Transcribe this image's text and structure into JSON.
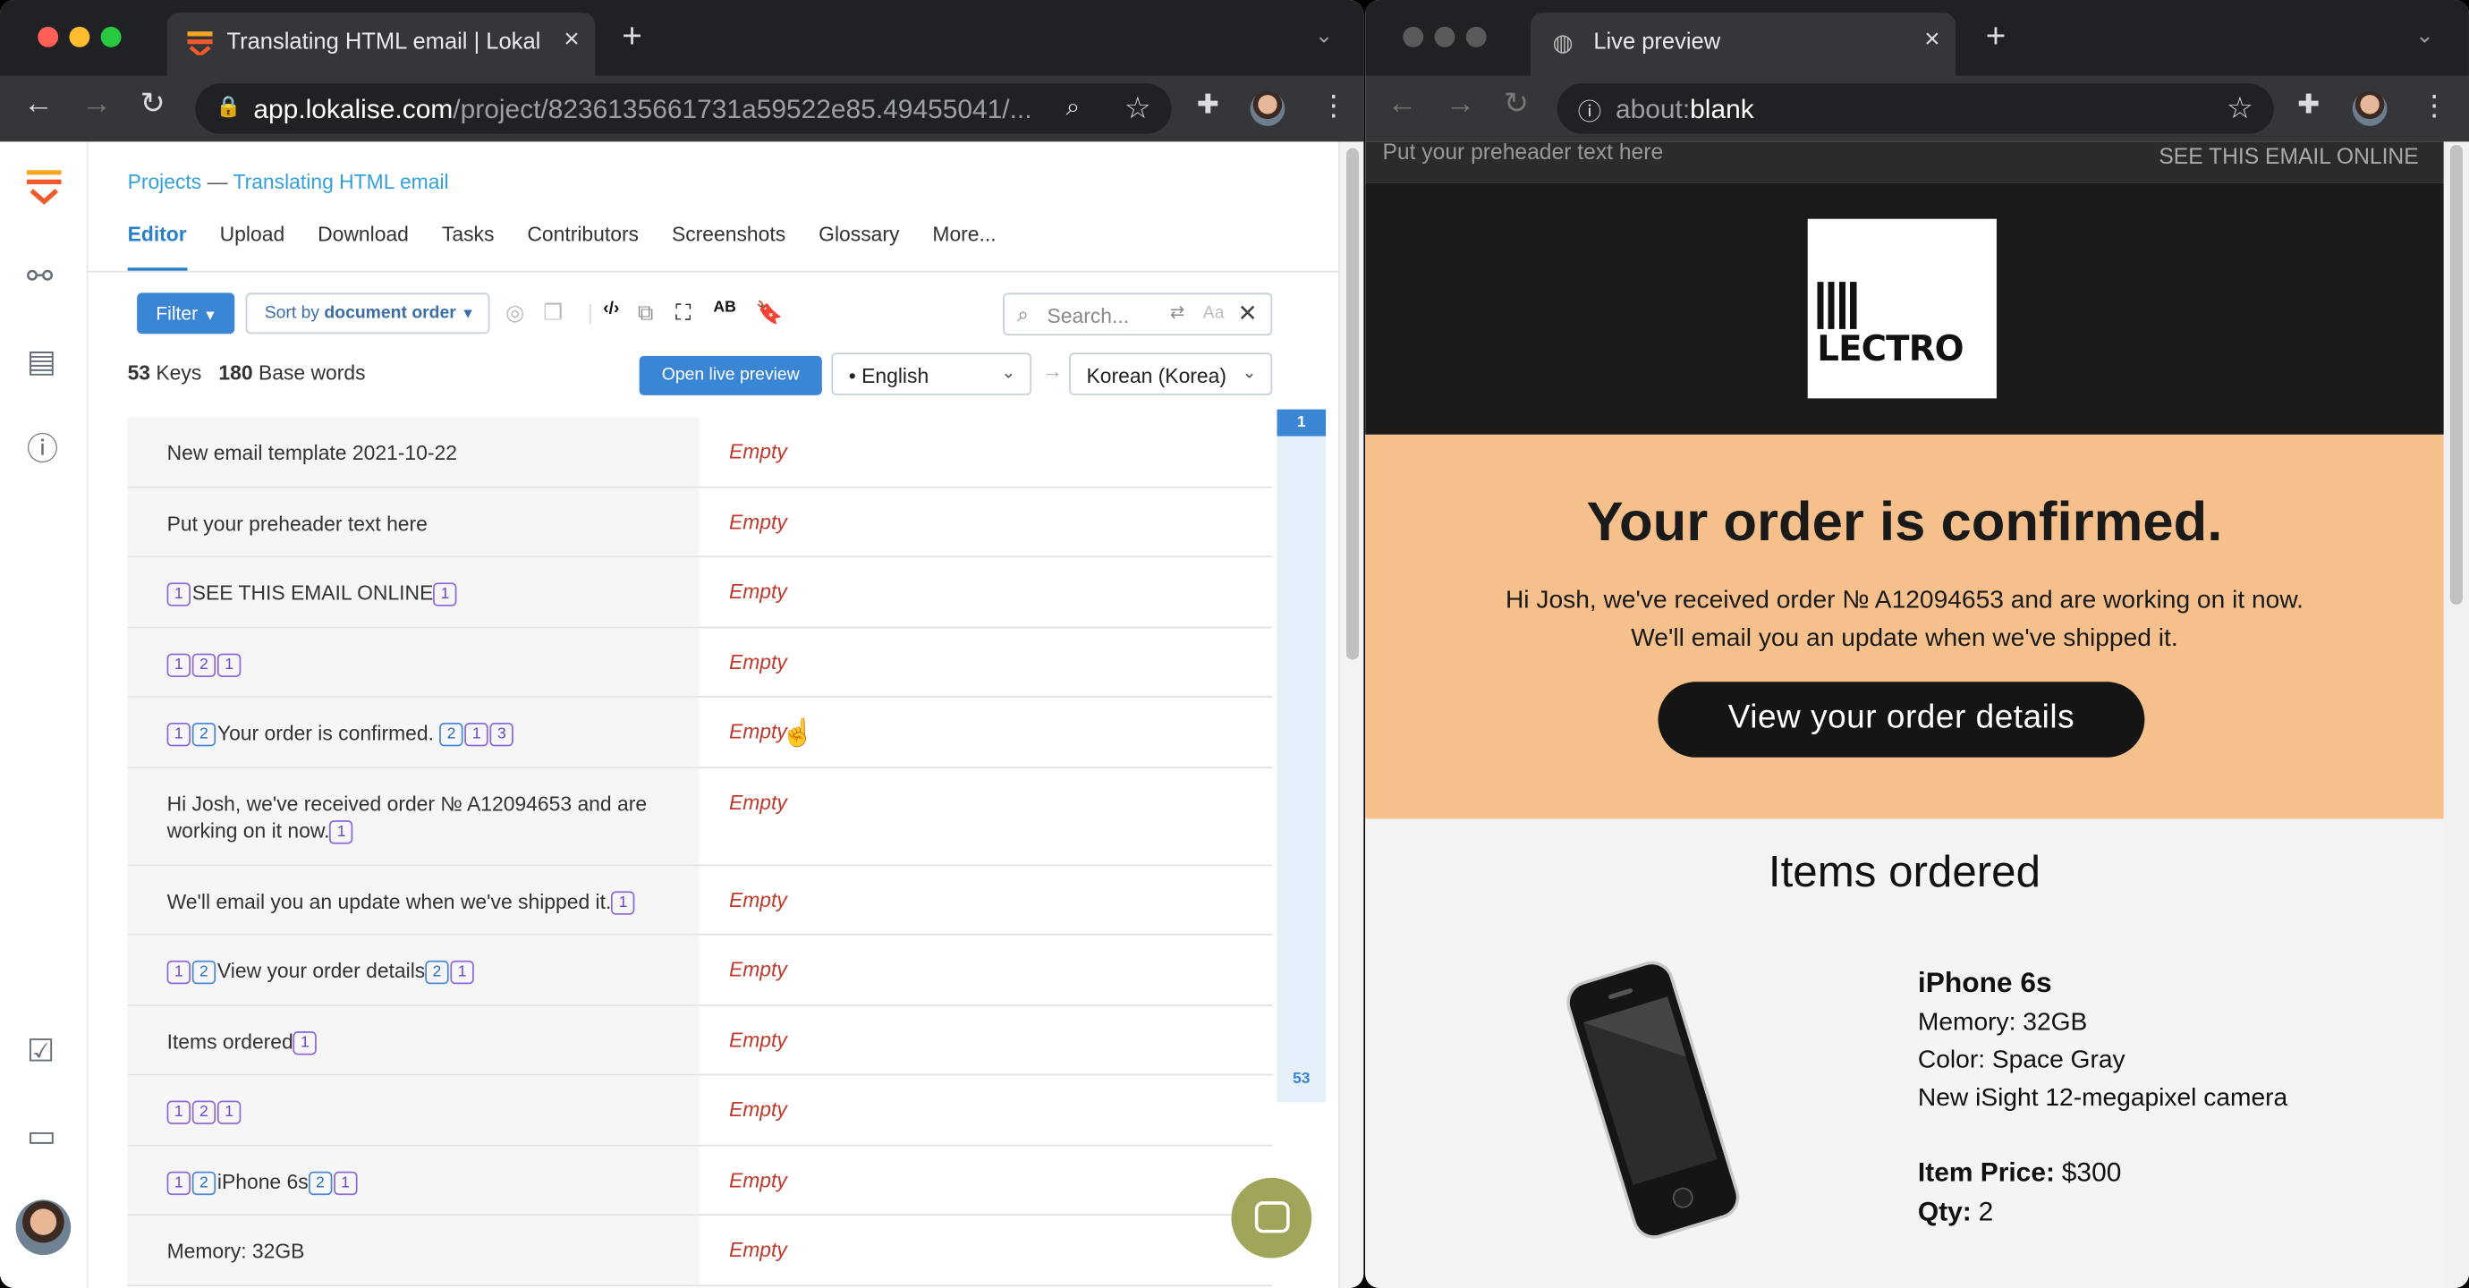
{
  "left_window": {
    "tab_title": "Translating HTML email | Lokali",
    "url_domain": "app.lokalise.com",
    "url_path": "/project/8236135661731a59522e85.49455041/..."
  },
  "right_window": {
    "tab_title": "Live preview",
    "url_prefix": "about:",
    "url_rest": "blank"
  },
  "lokalise": {
    "breadcrumb_projects": "Projects",
    "breadcrumb_sep": " — ",
    "breadcrumb_project": "Translating HTML email",
    "nav": [
      "Editor",
      "Upload",
      "Download",
      "Tasks",
      "Contributors",
      "Screenshots",
      "Glossary",
      "More..."
    ],
    "filter_label": "Filter",
    "sort_prefix": "Sort by ",
    "sort_value": "document order",
    "search_placeholder": "Search...",
    "search_case": "Aa",
    "keys_count": "53",
    "keys_label": "Keys",
    "words_count": "180",
    "words_label": "Base words",
    "live_preview_button": "Open live preview",
    "source_language": "• English",
    "target_language": "Korean (Korea)",
    "rail_top": "1",
    "rail_bottom": "53",
    "empty_label": "Empty"
  },
  "rows": [
    {
      "parts": [
        {
          "t": "New email template 2021-10-22"
        }
      ]
    },
    {
      "parts": [
        {
          "t": "Put your preheader text here"
        }
      ]
    },
    {
      "parts": [
        {
          "p": "1"
        },
        {
          "t": "SEE THIS EMAIL ONLINE"
        },
        {
          "p": "1"
        }
      ]
    },
    {
      "parts": [
        {
          "p": "1"
        },
        {
          "p": "2"
        },
        {
          "p": "1"
        }
      ]
    },
    {
      "parts": [
        {
          "p": "1"
        },
        {
          "p": "2",
          "b": 1
        },
        {
          "t": "Your order is confirmed. "
        },
        {
          "p": "2",
          "b": 1
        },
        {
          "p": "1"
        },
        {
          "p": "3"
        }
      ]
    },
    {
      "parts": [
        {
          "t": "Hi Josh, we've received order № A12094653 and are working on it now."
        },
        {
          "p": "1"
        }
      ],
      "tall": 1
    },
    {
      "parts": [
        {
          "t": "We'll email you an update when we've shipped it."
        },
        {
          "p": "1"
        }
      ]
    },
    {
      "parts": [
        {
          "p": "1"
        },
        {
          "p": "2",
          "b": 1
        },
        {
          "t": "View your order details"
        },
        {
          "p": "2",
          "b": 1
        },
        {
          "p": "1"
        }
      ]
    },
    {
      "parts": [
        {
          "t": "Items ordered"
        },
        {
          "p": "1"
        }
      ]
    },
    {
      "parts": [
        {
          "p": "1"
        },
        {
          "p": "2"
        },
        {
          "p": "1"
        }
      ]
    },
    {
      "parts": [
        {
          "p": "1"
        },
        {
          "p": "2",
          "b": 1
        },
        {
          "t": "iPhone 6s"
        },
        {
          "p": "2",
          "b": 1
        },
        {
          "p": "1"
        }
      ]
    },
    {
      "parts": [
        {
          "t": "Memory: 32GB"
        }
      ]
    }
  ],
  "email": {
    "preheader": "Put your preheader text here",
    "view_online": "SEE THIS EMAIL ONLINE",
    "logo_text": "LECTRO",
    "headline": "Your order is confirmed.",
    "body_line1": "Hi Josh, we've received order № A12094653 and are working on it now.",
    "body_line2": "We'll email you an update when we've shipped it.",
    "cta": "View your order details",
    "items_heading": "Items ordered",
    "product_name": "iPhone 6s",
    "memory": "Memory: 32GB",
    "color": "Color: Space Gray",
    "camera": "New iSight 12-megapixel camera",
    "price_label": "Item Price:",
    "price_value": "$300",
    "qty_label": "Qty:",
    "qty_value": "2"
  },
  "colors": {
    "accent": "#3b86d4",
    "hero_bg": "#f5c08c",
    "empty_text": "#c0392b"
  }
}
